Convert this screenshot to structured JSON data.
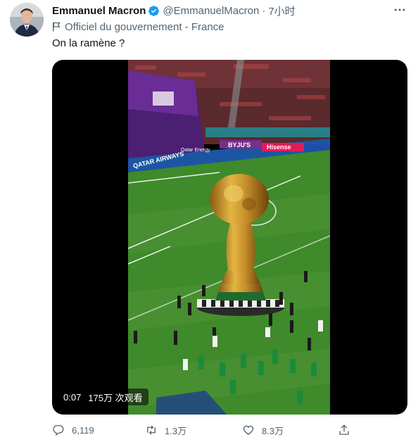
{
  "tweet": {
    "author_name": "Emmanuel Macron",
    "handle": "@EmmanuelMacron",
    "separator": "·",
    "time": "7小时",
    "label": "Officiel du gouvernement - France",
    "text": "On la ramène ?",
    "media": {
      "duration": "0:07",
      "views": "175万 次观看",
      "scoreboard_ads": [
        "QATAR AIRWAYS",
        "BYJU'S",
        "Hisense",
        "Qatar Energy"
      ]
    },
    "actions": {
      "reply_count": "6,119",
      "retweet_count": "1.3万",
      "like_count": "8.3万"
    }
  },
  "icons": [
    "verified-badge-icon",
    "more-icon",
    "flag-icon",
    "reply-icon",
    "retweet-icon",
    "like-icon",
    "share-icon"
  ],
  "colors": {
    "verified": "#1d9bf0",
    "secondary_text": "#536471",
    "pitch": "#3f8a2a"
  }
}
